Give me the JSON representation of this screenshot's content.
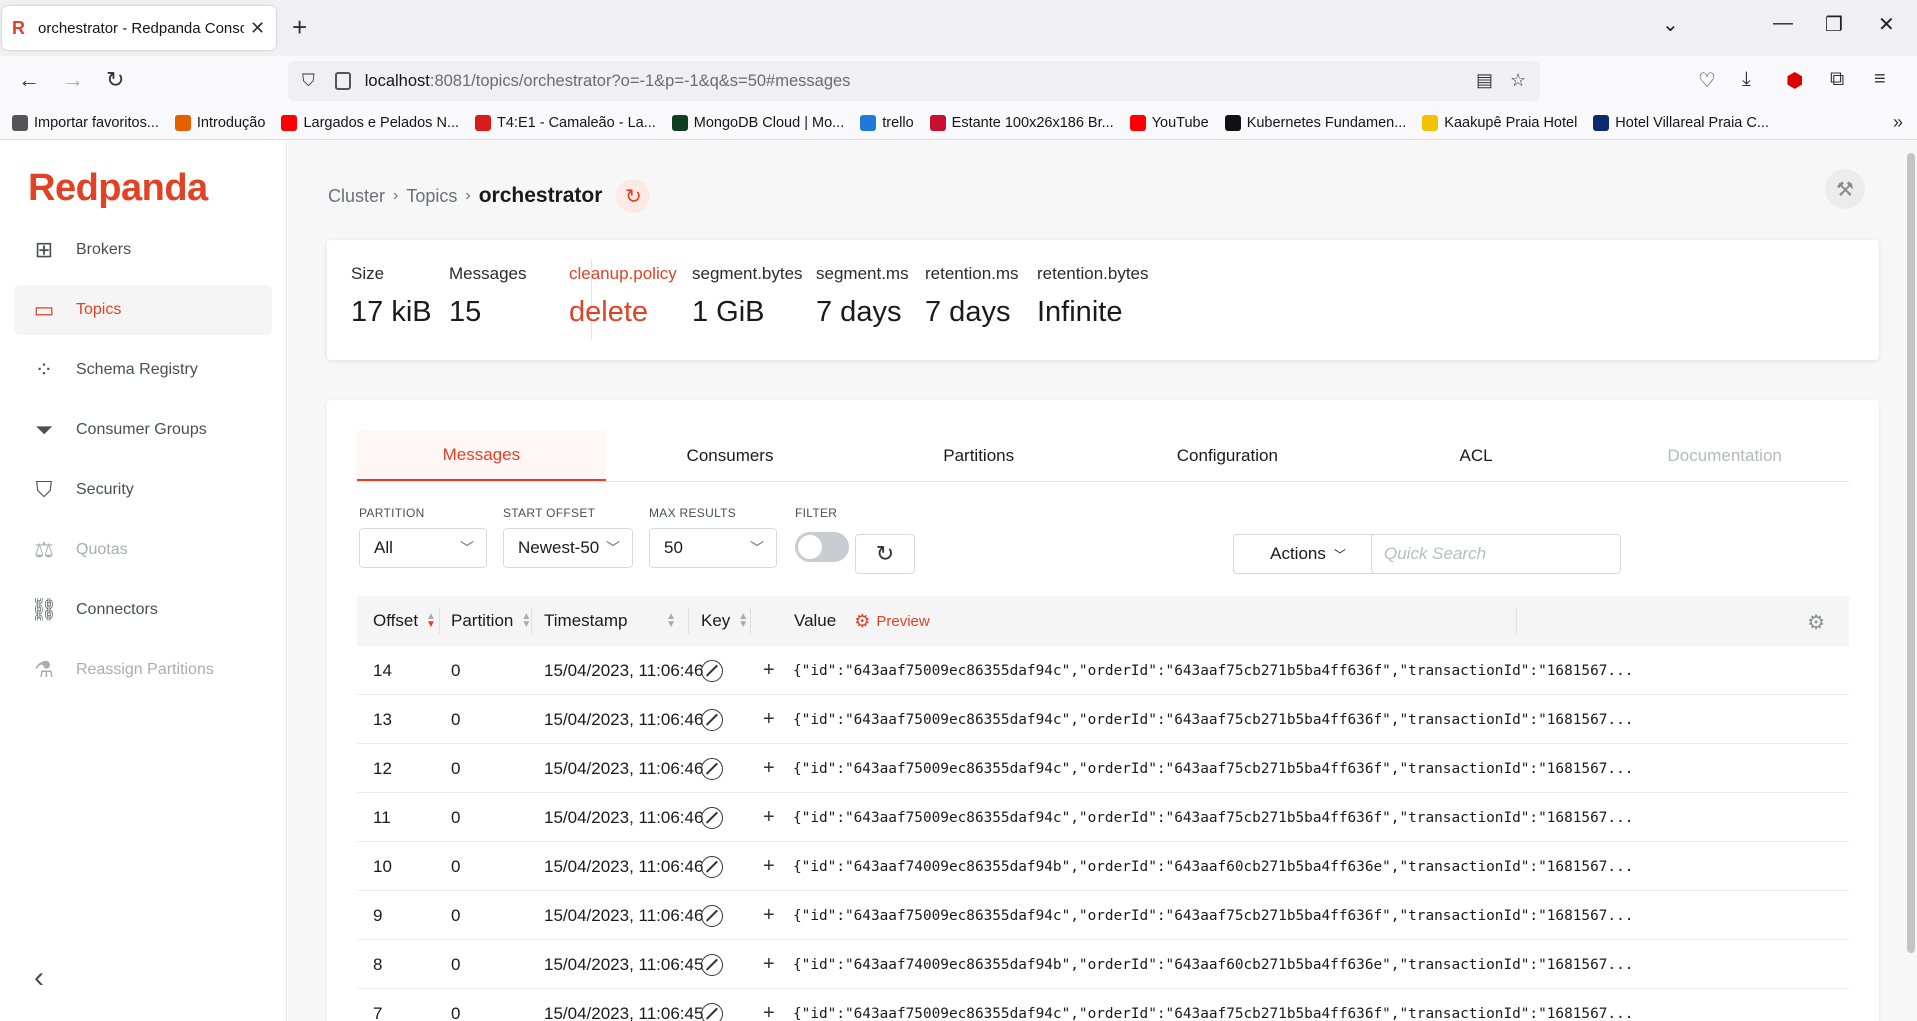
{
  "browser": {
    "tab_title": "orchestrator - Redpanda Console",
    "tab_favicon": "R",
    "url_host": "localhost",
    "url_rest": ":8081/topics/orchestrator?o=-1&p=-1&q&s=50#messages",
    "bookmarks": [
      {
        "label": "Importar favoritos...",
        "color": "#555555"
      },
      {
        "label": "Introdução",
        "color": "#e66000"
      },
      {
        "label": "Largados e Pelados N...",
        "color": "#ff0000"
      },
      {
        "label": "T4:E1 - Camaleão - La...",
        "color": "#d81b1b"
      },
      {
        "label": "MongoDB Cloud | Mo...",
        "color": "#0f3d1f"
      },
      {
        "label": "trello",
        "color": "#1c7ad6"
      },
      {
        "label": "Estante 100x26x186 Br...",
        "color": "#c8102e"
      },
      {
        "label": "YouTube",
        "color": "#ff0000"
      },
      {
        "label": "Kubernetes Fundamen...",
        "color": "#111111"
      },
      {
        "label": "Kaakupê Praia Hotel",
        "color": "#f2c200"
      },
      {
        "label": "Hotel Villareal Praia C...",
        "color": "#0a2a6b"
      }
    ]
  },
  "sidebar": {
    "logo": "Redpanda",
    "items": [
      {
        "label": "Brokers",
        "icon": "chip-icon",
        "state": "normal"
      },
      {
        "label": "Topics",
        "icon": "topics-icon",
        "state": "active"
      },
      {
        "label": "Schema Registry",
        "icon": "schema-icon",
        "state": "normal"
      },
      {
        "label": "Consumer Groups",
        "icon": "funnel-icon",
        "state": "normal"
      },
      {
        "label": "Security",
        "icon": "shield-icon",
        "state": "normal"
      },
      {
        "label": "Quotas",
        "icon": "scale-icon",
        "state": "disabled"
      },
      {
        "label": "Connectors",
        "icon": "link-icon",
        "state": "normal"
      },
      {
        "label": "Reassign Partitions",
        "icon": "flask-icon",
        "state": "disabled"
      }
    ]
  },
  "breadcrumb": {
    "cluster": "Cluster",
    "topics": "Topics",
    "current": "orchestrator"
  },
  "stats": [
    {
      "label": "Size",
      "value": "17 kiB",
      "danger": false
    },
    {
      "label": "Messages",
      "value": "15",
      "danger": false
    },
    {
      "label": "cleanup.policy",
      "value": "delete",
      "danger": true
    },
    {
      "label": "segment.bytes",
      "value": "1 GiB",
      "danger": false
    },
    {
      "label": "segment.ms",
      "value": "7 days",
      "danger": false
    },
    {
      "label": "retention.ms",
      "value": "7 days",
      "danger": false
    },
    {
      "label": "retention.bytes",
      "value": "Infinite",
      "danger": false
    }
  ],
  "tabs": [
    {
      "label": "Messages",
      "state": "active"
    },
    {
      "label": "Consumers",
      "state": "normal"
    },
    {
      "label": "Partitions",
      "state": "normal"
    },
    {
      "label": "Configuration",
      "state": "normal"
    },
    {
      "label": "ACL",
      "state": "normal"
    },
    {
      "label": "Documentation",
      "state": "disabled"
    }
  ],
  "filters": {
    "partition_label": "PARTITION",
    "partition_value": "All",
    "start_offset_label": "START OFFSET",
    "start_offset_value": "Newest-50",
    "max_results_label": "MAX RESULTS",
    "max_results_value": "50",
    "filter_label": "FILTER",
    "actions_label": "Actions",
    "search_placeholder": "Quick Search"
  },
  "table": {
    "headers": {
      "offset": "Offset",
      "partition": "Partition",
      "timestamp": "Timestamp",
      "key": "Key",
      "value": "Value",
      "preview": "Preview"
    },
    "rows": [
      {
        "offset": "14",
        "partition": "0",
        "timestamp": "15/04/2023, 11:06:46",
        "value": "{\"id\":\"643aaf75009ec86355daf94c\",\"orderId\":\"643aaf75cb271b5ba4ff636f\",\"transactionId\":\"1681567..."
      },
      {
        "offset": "13",
        "partition": "0",
        "timestamp": "15/04/2023, 11:06:46",
        "value": "{\"id\":\"643aaf75009ec86355daf94c\",\"orderId\":\"643aaf75cb271b5ba4ff636f\",\"transactionId\":\"1681567..."
      },
      {
        "offset": "12",
        "partition": "0",
        "timestamp": "15/04/2023, 11:06:46",
        "value": "{\"id\":\"643aaf75009ec86355daf94c\",\"orderId\":\"643aaf75cb271b5ba4ff636f\",\"transactionId\":\"1681567..."
      },
      {
        "offset": "11",
        "partition": "0",
        "timestamp": "15/04/2023, 11:06:46",
        "value": "{\"id\":\"643aaf75009ec86355daf94c\",\"orderId\":\"643aaf75cb271b5ba4ff636f\",\"transactionId\":\"1681567..."
      },
      {
        "offset": "10",
        "partition": "0",
        "timestamp": "15/04/2023, 11:06:46",
        "value": "{\"id\":\"643aaf74009ec86355daf94b\",\"orderId\":\"643aaf60cb271b5ba4ff636e\",\"transactionId\":\"1681567..."
      },
      {
        "offset": "9",
        "partition": "0",
        "timestamp": "15/04/2023, 11:06:46",
        "value": "{\"id\":\"643aaf75009ec86355daf94c\",\"orderId\":\"643aaf75cb271b5ba4ff636f\",\"transactionId\":\"1681567..."
      },
      {
        "offset": "8",
        "partition": "0",
        "timestamp": "15/04/2023, 11:06:45",
        "value": "{\"id\":\"643aaf74009ec86355daf94b\",\"orderId\":\"643aaf60cb271b5ba4ff636e\",\"transactionId\":\"1681567..."
      },
      {
        "offset": "7",
        "partition": "0",
        "timestamp": "15/04/2023, 11:06:45",
        "value": "{\"id\":\"643aaf75009ec86355daf94c\",\"orderId\":\"643aaf75cb271b5ba4ff636f\",\"transactionId\":\"1681567..."
      }
    ]
  },
  "colors": {
    "accent": "#e14225",
    "sidebar_text": "#4a4f55",
    "disabled": "#a8adb3"
  }
}
